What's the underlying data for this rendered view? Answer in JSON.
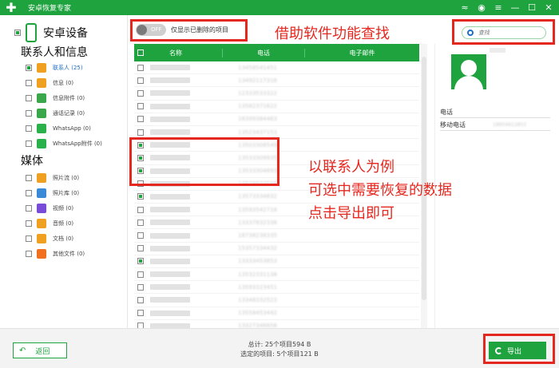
{
  "app": {
    "title": "安卓恢复专家"
  },
  "sidebar": {
    "device_label": "安卓设备",
    "section1": "联系人和信息",
    "section2": "媒体",
    "cats1": [
      {
        "label": "联系人 (25)",
        "icon": "contacts-icon",
        "color": "#f0a020",
        "checked": true,
        "active": true
      },
      {
        "label": "信息 (0)",
        "icon": "message-icon",
        "color": "#f0a020",
        "checked": false,
        "active": false
      },
      {
        "label": "信息附件 (0)",
        "icon": "attachment-icon",
        "color": "#3aa84a",
        "checked": false,
        "active": false
      },
      {
        "label": "通话记录 (0)",
        "icon": "call-log-icon",
        "color": "#3aa84a",
        "checked": false,
        "active": false
      },
      {
        "label": "WhatsApp (0)",
        "icon": "whatsapp-icon",
        "color": "#2bb14a",
        "checked": false,
        "active": false
      },
      {
        "label": "WhatsApp附件 (0)",
        "icon": "whatsapp-attachment-icon",
        "color": "#2bb14a",
        "checked": false,
        "active": false
      }
    ],
    "cats2": [
      {
        "label": "照片流 (0)",
        "icon": "photo-stream-icon",
        "color": "#f0a020",
        "checked": false,
        "active": false
      },
      {
        "label": "照片库 (0)",
        "icon": "photo-library-icon",
        "color": "#3a8ad8",
        "checked": false,
        "active": false
      },
      {
        "label": "视频 (0)",
        "icon": "video-icon",
        "color": "#7a4ad8",
        "checked": false,
        "active": false
      },
      {
        "label": "音频 (0)",
        "icon": "audio-icon",
        "color": "#f0a020",
        "checked": false,
        "active": false
      },
      {
        "label": "文档 (0)",
        "icon": "document-icon",
        "color": "#f0a020",
        "checked": false,
        "active": false
      },
      {
        "label": "其他文件 (0)",
        "icon": "other-files-icon",
        "color": "#f07020",
        "checked": false,
        "active": false
      }
    ]
  },
  "toolbar": {
    "toggle_state": "OFF",
    "toggle_label": "仅显示已删除的项目"
  },
  "search": {
    "placeholder": "查找"
  },
  "annotations": {
    "title": "借助软件功能查找",
    "body_lines": [
      "以联系人为例",
      "可选中需要恢复的数据",
      "点击导出即可"
    ]
  },
  "table": {
    "headers": [
      "名称",
      "电话",
      "电子邮件"
    ],
    "rows": [
      {
        "name": "",
        "phone": "13458541451",
        "checked": false
      },
      {
        "name": "",
        "phone": "13492117316",
        "checked": false
      },
      {
        "name": "",
        "phone": "12333533322",
        "checked": false
      },
      {
        "name": "",
        "phone": "13582371622",
        "checked": false
      },
      {
        "name": "",
        "phone": "18399384463",
        "checked": false
      },
      {
        "name": "",
        "phone": "13523437153",
        "checked": false
      },
      {
        "name": "",
        "phone": "13503308549",
        "checked": true
      },
      {
        "name": "",
        "phone": "13533309935",
        "checked": true
      },
      {
        "name": "",
        "phone": "13533304893",
        "checked": true
      },
      {
        "name": "",
        "phone": "13539933558",
        "checked": false
      },
      {
        "name": "",
        "phone": "13573334832",
        "checked": true
      },
      {
        "name": "",
        "phone": "13593542718",
        "checked": false
      },
      {
        "name": "",
        "phone": "13337832338",
        "checked": false
      },
      {
        "name": "",
        "phone": "18738238335",
        "checked": false
      },
      {
        "name": "",
        "phone": "15357334432",
        "checked": false
      },
      {
        "name": "",
        "phone": "13333453853",
        "checked": true
      },
      {
        "name": "",
        "phone": "13532331138",
        "checked": false
      },
      {
        "name": "",
        "phone": "13593323451",
        "checked": false
      },
      {
        "name": "",
        "phone": "13348332523",
        "checked": false
      },
      {
        "name": "",
        "phone": "13558453442",
        "checked": false
      },
      {
        "name": "",
        "phone": "13327346856",
        "checked": false
      },
      {
        "name": "",
        "phone": "14995363863",
        "checked": false
      }
    ]
  },
  "detail": {
    "phone_label": "电话",
    "mobile_label": "移动电话",
    "mobile_value": "18954612853"
  },
  "footer": {
    "back_label": "返回",
    "total": "总计: 25个项目594 B",
    "selected": "选定的项目: 5个项目121 B",
    "export_label": "导出"
  },
  "colors": {
    "brand": "#1ea33f",
    "annotation": "#e5281f"
  }
}
